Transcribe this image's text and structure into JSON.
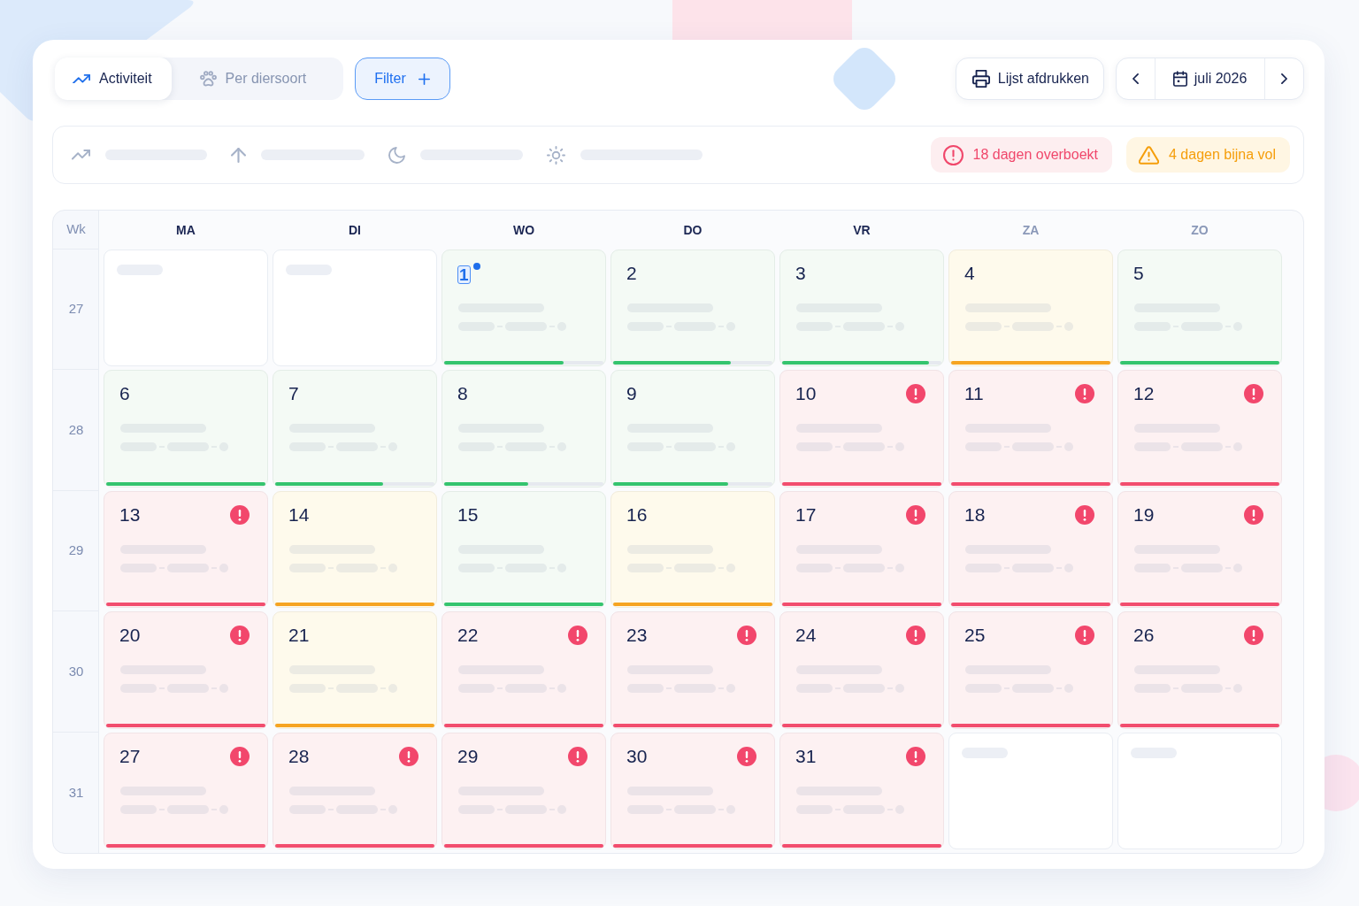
{
  "toolbar": {
    "tabs": [
      {
        "label": "Activiteit",
        "selected": true
      },
      {
        "label": "Per diersoort",
        "selected": false
      }
    ],
    "filter_button": {
      "label": "Filter"
    },
    "print_button": {
      "label": "Lijst afdrukken"
    },
    "month_picker": {
      "label": "juli 2026"
    }
  },
  "summary": {
    "alerts": [
      {
        "kind": "danger",
        "text": "18 dagen overboekt"
      },
      {
        "kind": "warning",
        "text": "4 dagen bijna vol"
      }
    ]
  },
  "calendar": {
    "week_heading": "Wk",
    "weekdays": [
      {
        "label": "MA",
        "weekend": false
      },
      {
        "label": "DI",
        "weekend": false
      },
      {
        "label": "WO",
        "weekend": false
      },
      {
        "label": "DO",
        "weekend": false
      },
      {
        "label": "VR",
        "weekend": false
      },
      {
        "label": "ZA",
        "weekend": true
      },
      {
        "label": "ZO",
        "weekend": true
      }
    ],
    "weeks": [
      {
        "number": "27",
        "days": [
          {
            "kind": "blank"
          },
          {
            "kind": "blank"
          },
          {
            "kind": "ok",
            "day": "1",
            "today": true,
            "level": 0.75
          },
          {
            "kind": "ok",
            "day": "2",
            "today": false,
            "level": 0.74
          },
          {
            "kind": "ok",
            "day": "3",
            "today": false,
            "level": 0.92
          },
          {
            "kind": "busy",
            "day": "4",
            "today": false,
            "level": 1
          },
          {
            "kind": "ok",
            "day": "5",
            "today": false,
            "level": 1
          }
        ]
      },
      {
        "number": "28",
        "days": [
          {
            "kind": "ok",
            "day": "6",
            "today": false,
            "level": 1
          },
          {
            "kind": "ok",
            "day": "7",
            "today": false,
            "level": 0.68
          },
          {
            "kind": "ok",
            "day": "8",
            "today": false,
            "level": 0.53
          },
          {
            "kind": "ok",
            "day": "9",
            "today": false,
            "level": 0.72
          },
          {
            "kind": "full",
            "day": "10",
            "today": false,
            "level": 1
          },
          {
            "kind": "full",
            "day": "11",
            "today": false,
            "level": 1
          },
          {
            "kind": "full",
            "day": "12",
            "today": false,
            "level": 1
          }
        ]
      },
      {
        "number": "29",
        "days": [
          {
            "kind": "full",
            "day": "13",
            "today": false,
            "level": 1
          },
          {
            "kind": "busy",
            "day": "14",
            "today": false,
            "level": 1
          },
          {
            "kind": "ok",
            "day": "15",
            "today": false,
            "level": 1
          },
          {
            "kind": "busy",
            "day": "16",
            "today": false,
            "level": 1
          },
          {
            "kind": "full",
            "day": "17",
            "today": false,
            "level": 1
          },
          {
            "kind": "full",
            "day": "18",
            "today": false,
            "level": 1
          },
          {
            "kind": "full",
            "day": "19",
            "today": false,
            "level": 1
          }
        ]
      },
      {
        "number": "30",
        "days": [
          {
            "kind": "full",
            "day": "20",
            "today": false,
            "level": 1
          },
          {
            "kind": "busy",
            "day": "21",
            "today": false,
            "level": 1
          },
          {
            "kind": "full",
            "day": "22",
            "today": false,
            "level": 1
          },
          {
            "kind": "full",
            "day": "23",
            "today": false,
            "level": 1
          },
          {
            "kind": "full",
            "day": "24",
            "today": false,
            "level": 1
          },
          {
            "kind": "full",
            "day": "25",
            "today": false,
            "level": 1
          },
          {
            "kind": "full",
            "day": "26",
            "today": false,
            "level": 1
          }
        ]
      },
      {
        "number": "31",
        "days": [
          {
            "kind": "full",
            "day": "27",
            "today": false,
            "level": 1
          },
          {
            "kind": "full",
            "day": "28",
            "today": false,
            "level": 1
          },
          {
            "kind": "full",
            "day": "29",
            "today": false,
            "level": 1
          },
          {
            "kind": "full",
            "day": "30",
            "today": false,
            "level": 1
          },
          {
            "kind": "full",
            "day": "31",
            "today": false,
            "level": 1
          },
          {
            "kind": "blank"
          },
          {
            "kind": "blank"
          }
        ]
      }
    ]
  }
}
